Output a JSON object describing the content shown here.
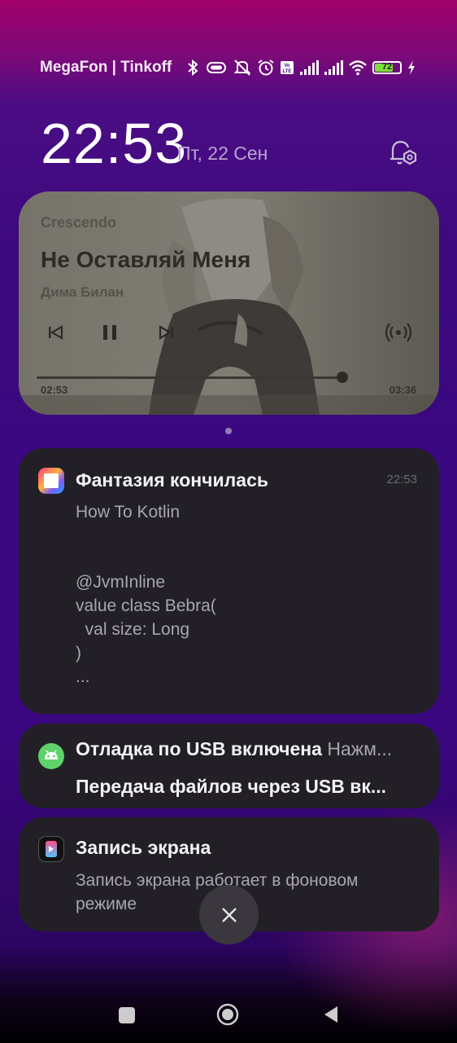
{
  "status_bar": {
    "carrier": "MegaFon | Tinkoff",
    "battery_level": "72",
    "battery_fraction": 0.72,
    "battery_color": "#7be03a",
    "icons": [
      "bluetooth-icon",
      "vibrate-icon",
      "mute-icon",
      "alarm-icon",
      "volte-icon",
      "signal-icon",
      "signal-icon",
      "wifi-icon",
      "battery-icon",
      "charging-icon"
    ]
  },
  "header": {
    "time": "22:53",
    "date": "Пт, 22 Сен"
  },
  "media": {
    "app_name": "Crescendo",
    "title": "Не Оставляй Меня",
    "artist": "Дима Билан",
    "elapsed": "02:53",
    "duration": "03:36",
    "progress": 0.8
  },
  "notifications": [
    {
      "title": "Фантазия кончилась",
      "time": "22:53",
      "subtitle": "How To Kotlin",
      "body": "@JvmInline\nvalue class Bebra(\n  val size: Long\n)\n..."
    },
    {
      "title": "Отладка по USB включена",
      "title_suffix": "Нажм...",
      "body": "Передача файлов через USB вк..."
    },
    {
      "title": "Запись экрана",
      "body": "Запись экрана работает в фоновом\nрежиме"
    }
  ]
}
